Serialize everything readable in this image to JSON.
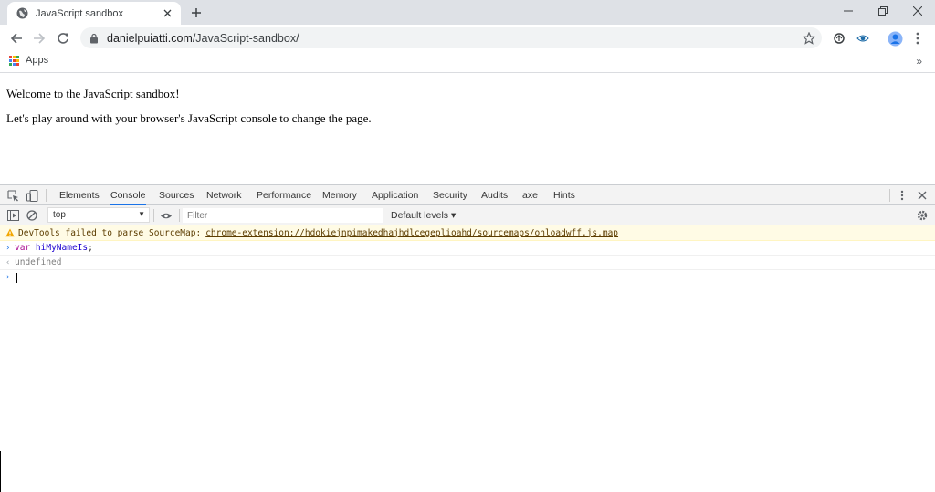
{
  "tab": {
    "title": "JavaScript sandbox",
    "close": "✕"
  },
  "newtab": "+",
  "window": {
    "minimize": "–",
    "restore": "❐",
    "close": "✕"
  },
  "address": {
    "host": "danielpuiatti.com",
    "path": "/JavaScript-sandbox/"
  },
  "bookmarks": {
    "apps_label": "Apps",
    "more": "»"
  },
  "page": {
    "line1": "Welcome to the JavaScript sandbox!",
    "line2": "Let's play around with your browser's JavaScript console to change the page."
  },
  "devtools": {
    "tabs": [
      "Elements",
      "Console",
      "Sources",
      "Network",
      "Performance",
      "Memory",
      "Application",
      "Security",
      "Audits",
      "axe",
      "Hints"
    ],
    "active_tab": "Console",
    "context": "top",
    "filter_placeholder": "Filter",
    "levels": "Default levels ▾"
  },
  "console": {
    "warning_text": "DevTools failed to parse SourceMap:",
    "warning_link": "chrome-extension://hdokiejnpimakedhajhdlcegeplioahd/sourcemaps/onloadwff.js.map",
    "input_keyword": "var",
    "input_ident": "hiMyNameIs",
    "input_punct": ";",
    "output": "undefined",
    "prompt_chevron": "›",
    "output_chevron": "‹"
  },
  "colors": {
    "accent": "#1a73e8",
    "tabstrip": "#dee1e6",
    "warning_bg": "#fffbe5"
  }
}
